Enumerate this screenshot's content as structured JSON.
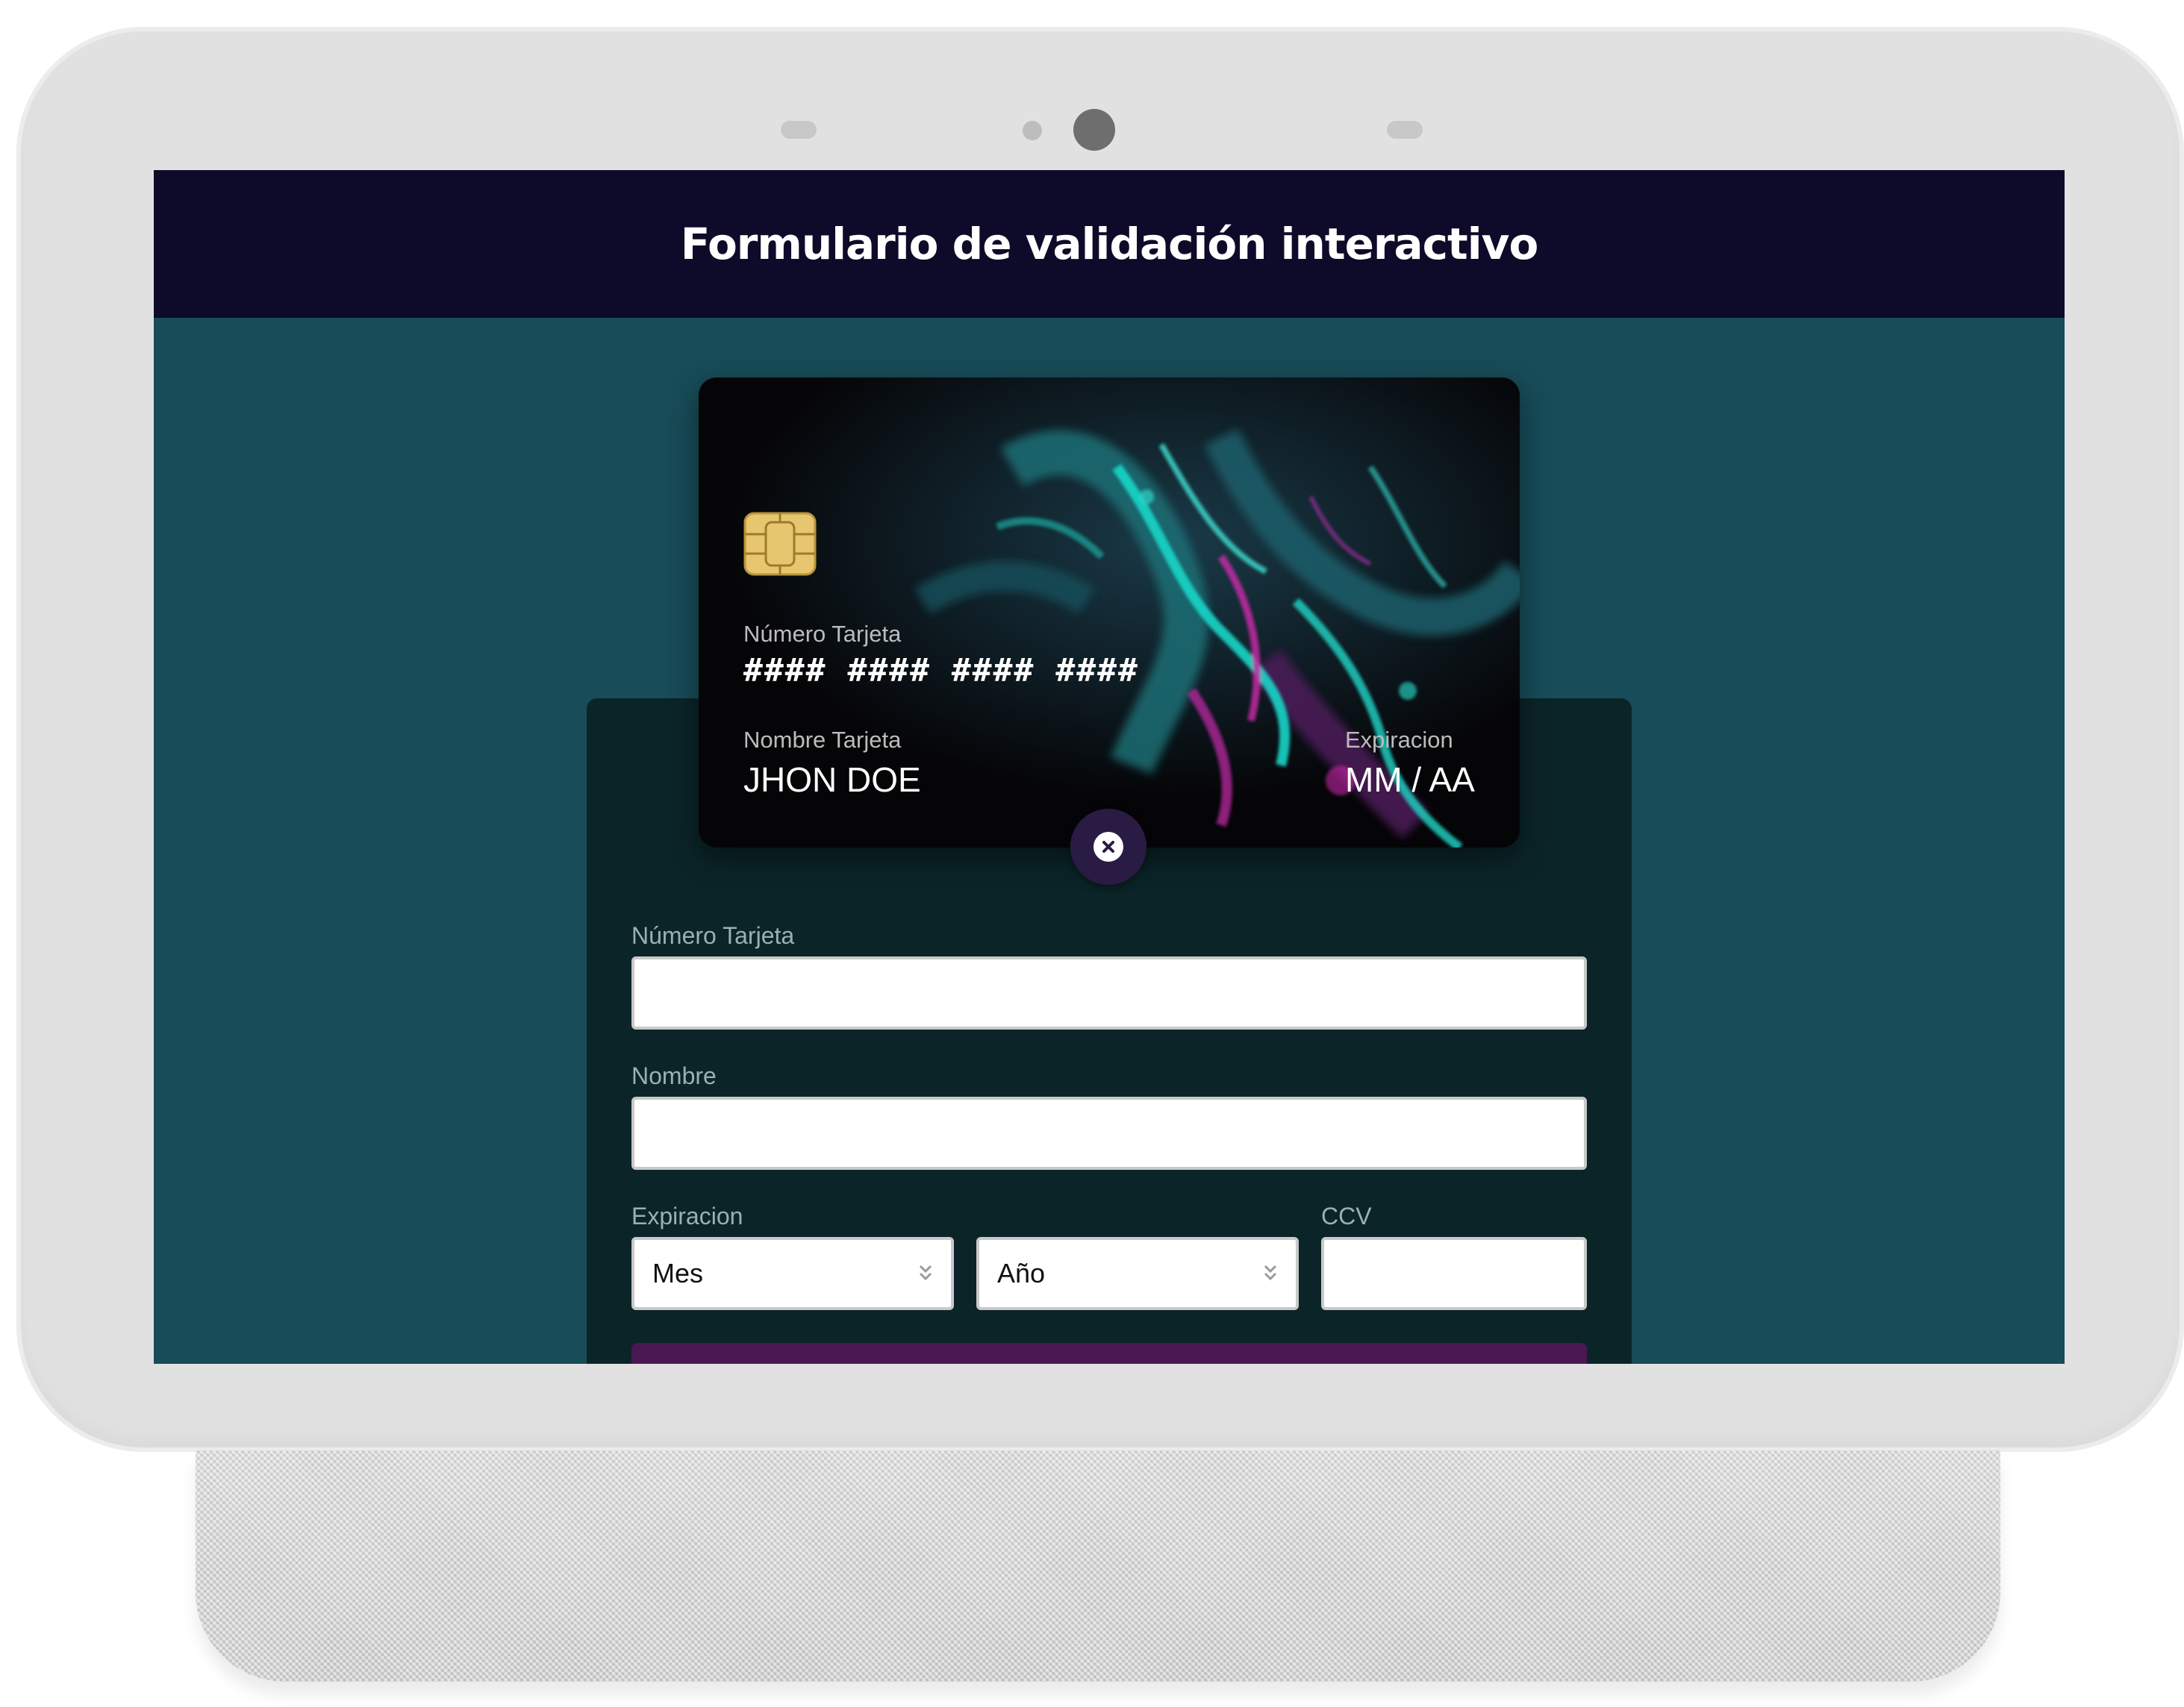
{
  "app": {
    "title": "Formulario de validación interactivo"
  },
  "card_preview": {
    "number_label": "Número Tarjeta",
    "number_value": "#### #### #### ####",
    "name_label": "Nombre Tarjeta",
    "name_value": "JHON DOE",
    "expiry_label": "Expiracion",
    "expiry_value": "MM / AA",
    "close_icon": "close-circle-icon"
  },
  "form": {
    "card_number_label": "Número Tarjeta",
    "card_number_value": "",
    "name_label": "Nombre",
    "name_value": "",
    "expiry_label": "Expiracion",
    "month_selected": "Mes",
    "year_selected": "Año",
    "ccv_label": "CCV",
    "ccv_value": ""
  },
  "colors": {
    "header_bg": "#0e0a29",
    "page_bg": "#174c58",
    "panel_bg": "#0b2428",
    "submit_bg": "#4a1753",
    "card_accent_teal": "#19d6c8",
    "card_accent_magenta": "#c42aa6"
  }
}
